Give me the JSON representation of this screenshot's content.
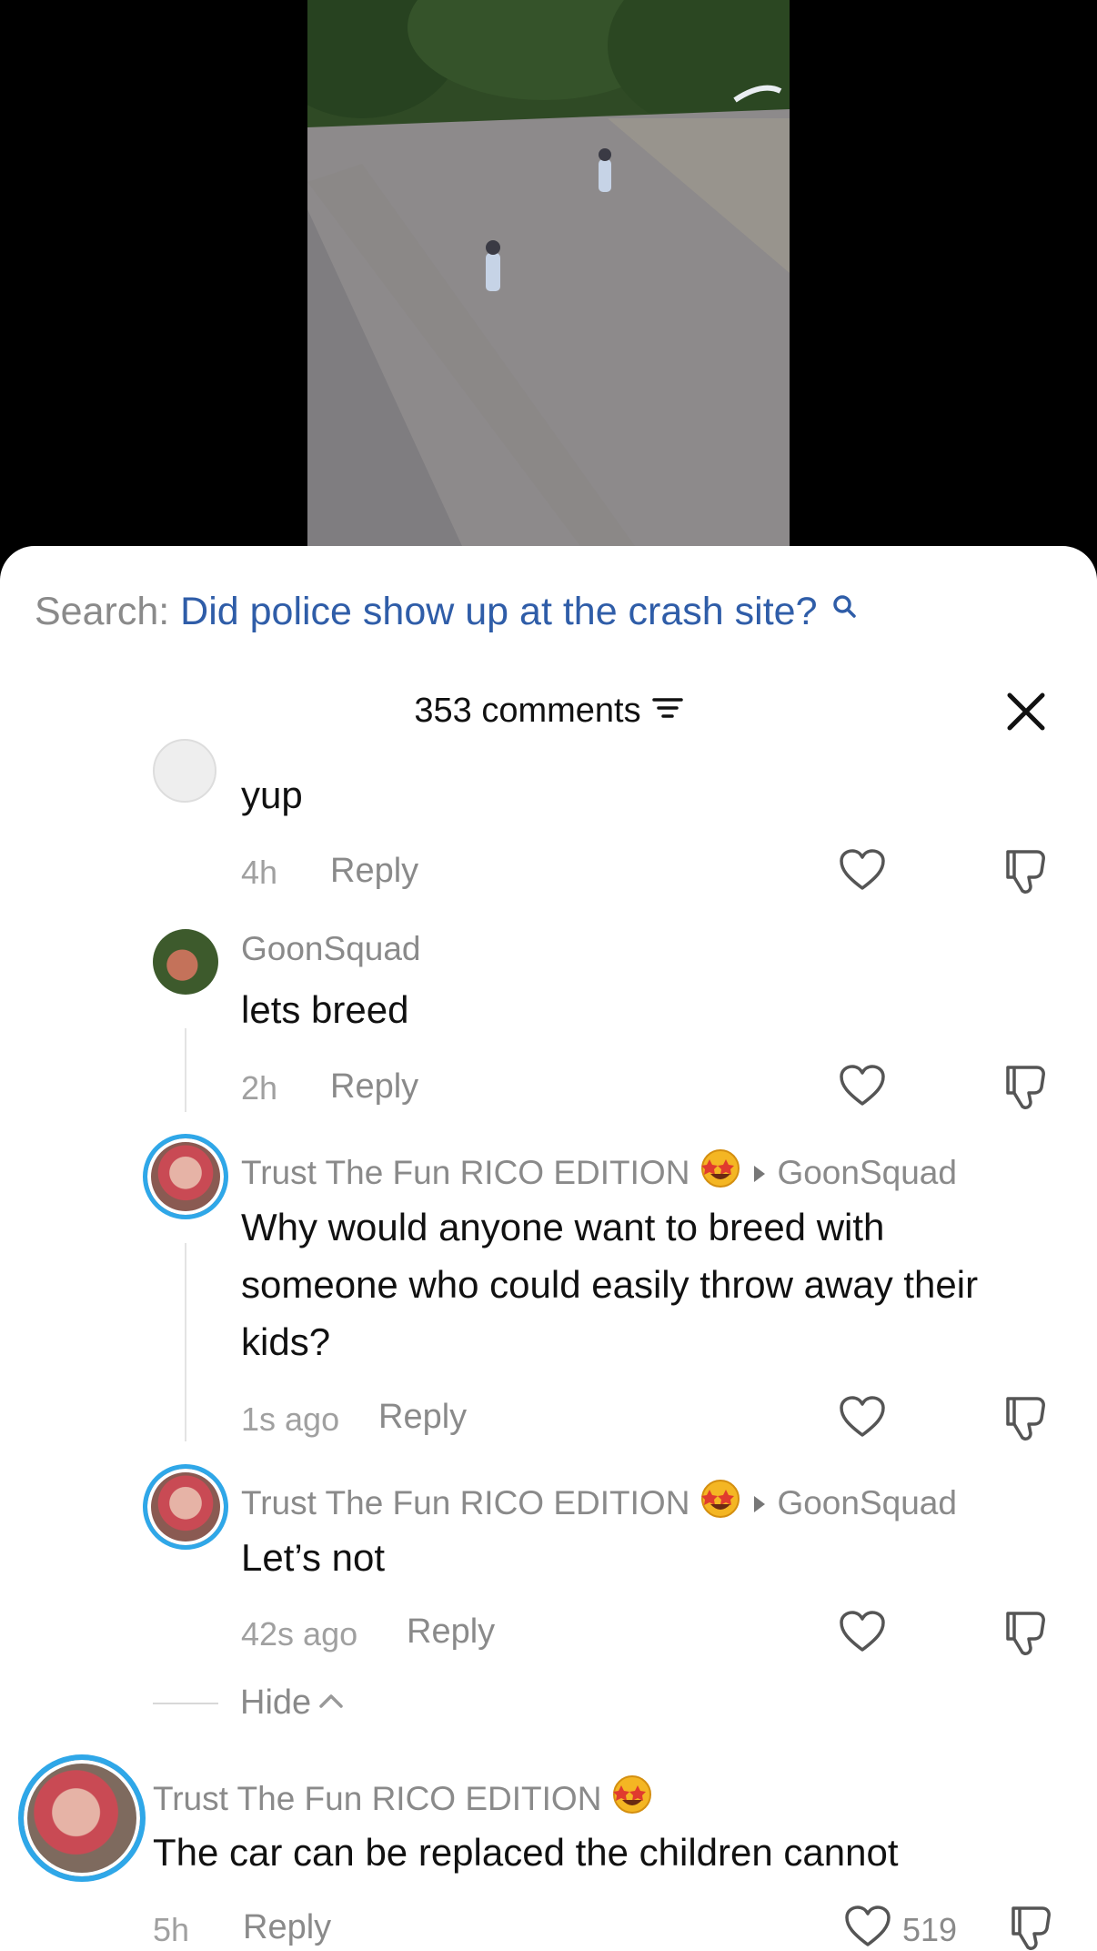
{
  "search": {
    "label": "Search:",
    "query": "Did police show up at the crash site?"
  },
  "comments_header": {
    "title": "353 comments"
  },
  "comments": [
    {
      "text": "yup",
      "time": "4h",
      "reply_label": "Reply"
    },
    {
      "username": "GoonSquad",
      "text": "lets breed",
      "time": "2h",
      "reply_label": "Reply"
    },
    {
      "username": "Trust The Fun RICO EDITION",
      "reply_to": "GoonSquad",
      "text": "Why would anyone want to breed with someone who could easily throw away their kids?",
      "time": "1s ago",
      "reply_label": "Reply"
    },
    {
      "username": "Trust The Fun RICO EDITION",
      "reply_to": "GoonSquad",
      "text": "Let’s not",
      "time": "42s ago",
      "reply_label": "Reply"
    },
    {
      "username": "Trust The Fun RICO EDITION",
      "text": "The car can be replaced the children cannot",
      "time": "5h",
      "reply_label": "Reply",
      "likes": "519"
    }
  ],
  "hide_label": "Hide",
  "icons": {
    "search": "search-icon",
    "filter": "filter-icon",
    "close": "close-icon",
    "like": "heart-icon",
    "dislike": "thumbs-down-icon",
    "reply_arrow": "caret-right-icon",
    "emoji": "star-struck-emoji",
    "hide_chevron": "chevron-up-icon"
  },
  "colors": {
    "accent_link": "#2f5da8",
    "avatar_ring": "#2fa7e8",
    "secondary_text": "#8a8a8a"
  }
}
